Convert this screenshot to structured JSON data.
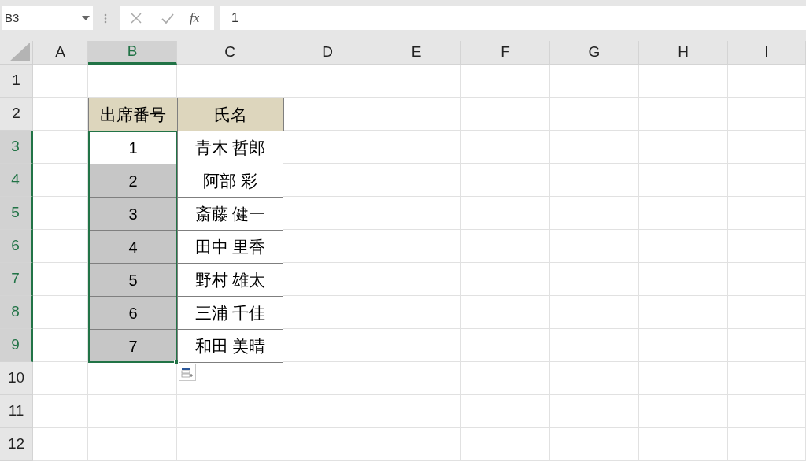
{
  "name_box": {
    "value": "B3"
  },
  "formula_bar": {
    "function_label": "fx",
    "value": "1"
  },
  "columns": [
    {
      "label": "A",
      "selected": false
    },
    {
      "label": "B",
      "selected": true
    },
    {
      "label": "C",
      "selected": false
    },
    {
      "label": "D",
      "selected": false
    },
    {
      "label": "E",
      "selected": false
    },
    {
      "label": "F",
      "selected": false
    },
    {
      "label": "G",
      "selected": false
    },
    {
      "label": "H",
      "selected": false
    },
    {
      "label": "I",
      "selected": false
    }
  ],
  "rows": [
    {
      "label": "1",
      "selected": false
    },
    {
      "label": "2",
      "selected": false
    },
    {
      "label": "3",
      "selected": true
    },
    {
      "label": "4",
      "selected": true
    },
    {
      "label": "5",
      "selected": true
    },
    {
      "label": "6",
      "selected": true
    },
    {
      "label": "7",
      "selected": true
    },
    {
      "label": "8",
      "selected": true
    },
    {
      "label": "9",
      "selected": true
    },
    {
      "label": "10",
      "selected": false
    },
    {
      "label": "11",
      "selected": false
    },
    {
      "label": "12",
      "selected": false
    }
  ],
  "table": {
    "headers": [
      "出席番号",
      "氏名"
    ],
    "rows": [
      {
        "number": "1",
        "name": "青木 哲郎",
        "selected": true,
        "active": true
      },
      {
        "number": "2",
        "name": "阿部 彩",
        "selected": true,
        "active": false
      },
      {
        "number": "3",
        "name": "斎藤 健一",
        "selected": true,
        "active": false
      },
      {
        "number": "4",
        "name": "田中 里香",
        "selected": true,
        "active": false
      },
      {
        "number": "5",
        "name": "野村 雄太",
        "selected": true,
        "active": false
      },
      {
        "number": "6",
        "name": "三浦 千佳",
        "selected": true,
        "active": false
      },
      {
        "number": "7",
        "name": "和田 美晴",
        "selected": true,
        "active": false
      }
    ]
  }
}
